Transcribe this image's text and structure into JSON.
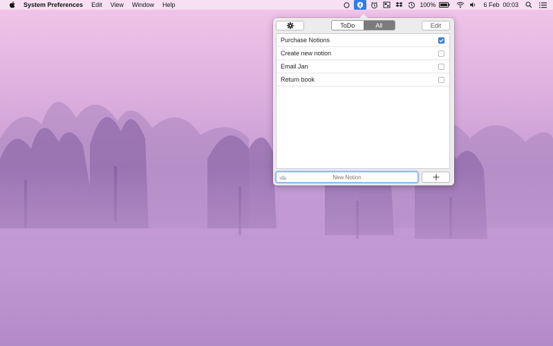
{
  "menubar": {
    "app_name": "System Preferences",
    "menus": [
      "Edit",
      "View",
      "Window",
      "Help"
    ],
    "status_icons": [
      "circle-icon",
      "notions-icon",
      "alarm-icon",
      "screen-icon",
      "dropbox-icon",
      "time-machine-icon"
    ],
    "battery": "100%",
    "date": "6 Feb",
    "time": "00:03"
  },
  "popover": {
    "settings_icon": "gear-icon",
    "segments": [
      "ToDo",
      "All"
    ],
    "selected_segment": "All",
    "edit_label": "Edit",
    "items": [
      {
        "label": "Purchase Notions",
        "checked": true
      },
      {
        "label": "Create new notion",
        "checked": false
      },
      {
        "label": "Email Jan",
        "checked": false
      },
      {
        "label": "Return book",
        "checked": false
      }
    ],
    "new_placeholder": "New Notion",
    "add_icon": "plus-icon"
  },
  "colors": {
    "accent": "#3b84e3",
    "segment_selected": "#7b7b7b",
    "menubar_active": "#2f7be7"
  }
}
